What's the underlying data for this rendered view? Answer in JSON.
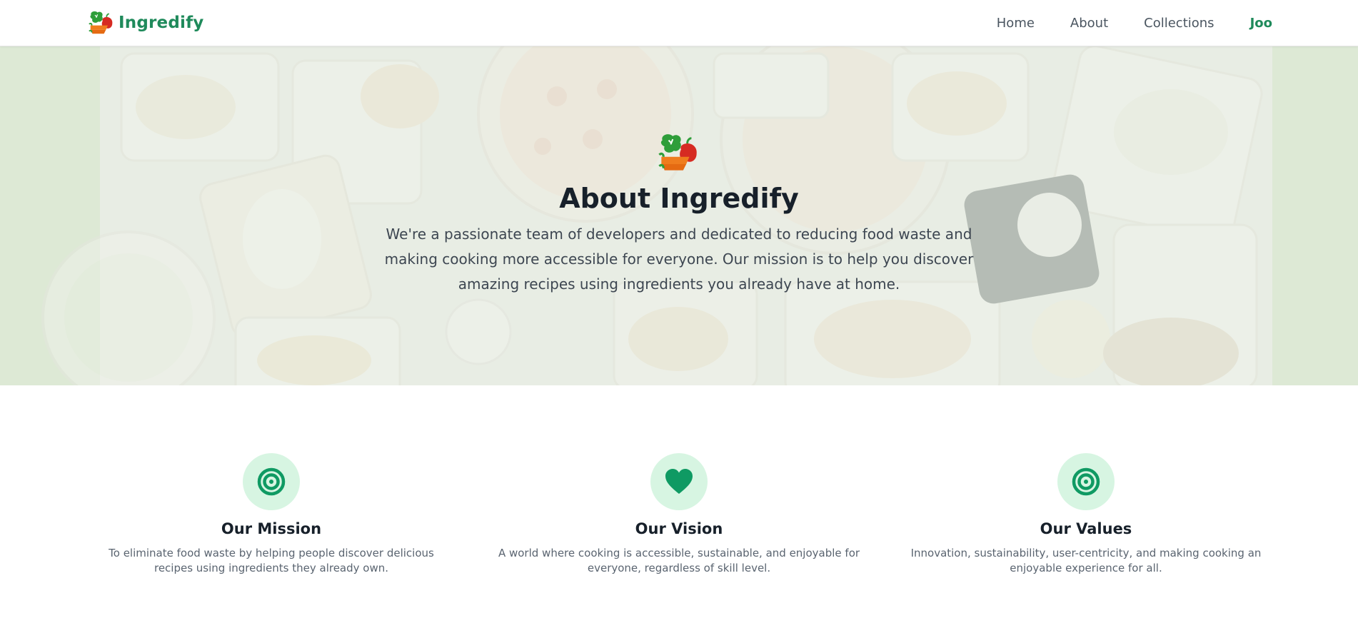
{
  "brand": {
    "name": "Ingredify",
    "logo_icon": "veggie-logo-icon"
  },
  "nav": {
    "links": [
      "Home",
      "About",
      "Collections"
    ],
    "user": "Joo"
  },
  "hero": {
    "title": "About Ingredify",
    "description": "We're a passionate team of developers and dedicated to reducing food waste and making cooking more accessible for everyone. Our mission is to help you discover amazing recipes using ingredients you already have at home."
  },
  "features": [
    {
      "icon": "target-icon",
      "title": "Our Mission",
      "description": "To eliminate food waste by helping people discover delicious recipes using ingredients they already own."
    },
    {
      "icon": "heart-icon",
      "title": "Our Vision",
      "description": "A world where cooking is accessible, sustainable, and enjoyable for everyone, regardless of skill level."
    },
    {
      "icon": "target-icon",
      "title": "Our Values",
      "description": "Innovation, sustainability, user-centricity, and making cooking an enjoyable experience for all."
    }
  ],
  "colors": {
    "accent": "#1f8a5b",
    "icon_bg": "#d7f5e2",
    "icon_fg": "#0f9a63"
  }
}
